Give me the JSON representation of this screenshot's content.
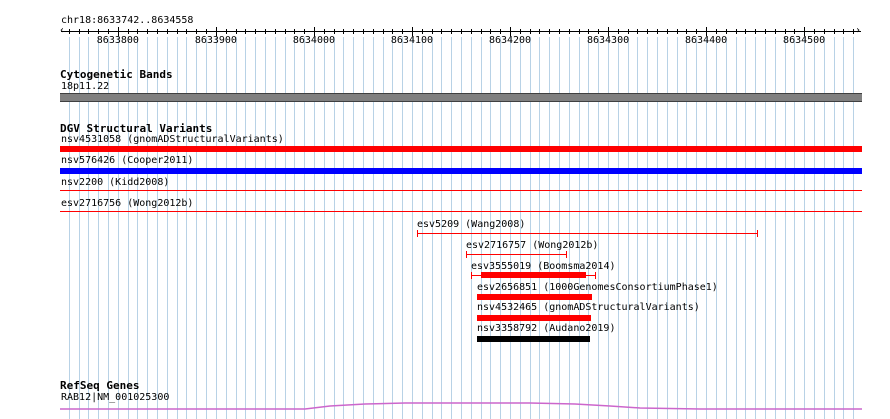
{
  "ruler": {
    "location": "chr18:8633742..8634558",
    "ticks": [
      "8633800",
      "8633900",
      "8634000",
      "8634100",
      "8634200",
      "8634300",
      "8634400",
      "8634500"
    ]
  },
  "tracks": {
    "cytoband": {
      "title": "Cytogenetic Bands",
      "band": "18p11.22"
    },
    "dgv": {
      "title": "DGV Structural Variants",
      "features": [
        {
          "label": "nsv4531058 (gnomADStructuralVariants)",
          "color": "#ff0000",
          "style": "thick"
        },
        {
          "label": "nsv576426 (Cooper2011)",
          "color": "#0000ff",
          "style": "thick"
        },
        {
          "label": "nsv2200 (Kidd2008)",
          "color": "#ff0000",
          "style": "thin"
        },
        {
          "label": "esv2716756 (Wong2012b)",
          "color": "#ff0000",
          "style": "thin"
        },
        {
          "label": "esv5209 (Wang2008)",
          "color": "#ff0000",
          "style": "whisker"
        },
        {
          "label": "esv2716757 (Wong2012b)",
          "color": "#ff0000",
          "style": "whisker"
        },
        {
          "label": "esv3555019 (Boomsma2014)",
          "color": "#ff0000",
          "style": "thick-whisker"
        },
        {
          "label": "esv2656851 (1000GenomesConsortiumPhase1)",
          "color": "#ff0000",
          "style": "thick"
        },
        {
          "label": "nsv4532465 (gnomADStructuralVariants)",
          "color": "#ff0000",
          "style": "thick"
        },
        {
          "label": "nsv3358792 (Audano2019)",
          "color": "#000000",
          "style": "thick"
        }
      ]
    },
    "refseq": {
      "title": "RefSeq Genes",
      "gene": "RAB12|NM_001025300",
      "color": "#cc66cc"
    }
  }
}
